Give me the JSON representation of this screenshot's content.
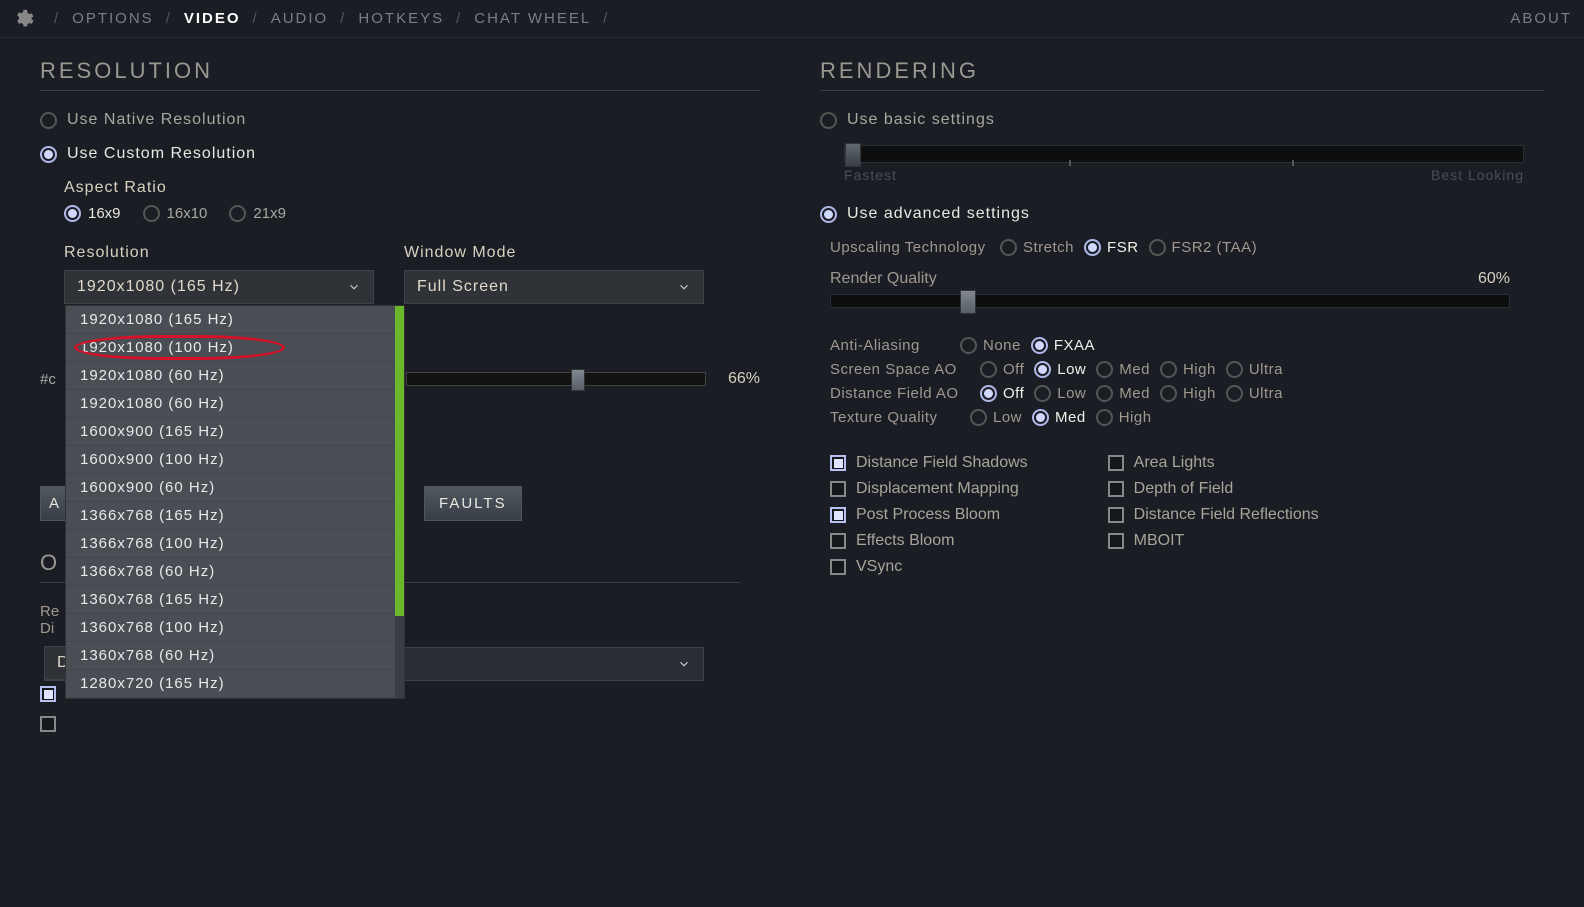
{
  "tabs": {
    "options": "OPTIONS",
    "video": "VIDEO",
    "audio": "AUDIO",
    "hotkeys": "HOTKEYS",
    "chatwheel": "CHAT WHEEL",
    "about": "ABOUT"
  },
  "left": {
    "title": "RESOLUTION",
    "native": "Use Native Resolution",
    "custom": "Use Custom Resolution",
    "aspect_label": "Aspect Ratio",
    "aspects": {
      "a1": "16x9",
      "a2": "16x10",
      "a3": "21x9"
    },
    "res_label": "Resolution",
    "res_selected": "1920x1080 (165 Hz)",
    "res_options": [
      "1920x1080 (165 Hz)",
      "1920x1080 (100 Hz)",
      "1920x1080 (60 Hz)",
      "1920x1080 (60 Hz)",
      "1600x900 (165 Hz)",
      "1600x900 (100 Hz)",
      "1600x900 (60 Hz)",
      "1366x768 (165 Hz)",
      "1366x768 (100 Hz)",
      "1366x768 (60 Hz)",
      "1360x768 (165 Hz)",
      "1360x768 (100 Hz)",
      "1360x768 (60 Hz)",
      "1280x720 (165 Hz)"
    ],
    "win_label": "Window Mode",
    "win_selected": "Full Screen",
    "obscured_slider_prefix": "#c",
    "obscured_slider_val": "66%",
    "apply_btn": "A",
    "defaults_btn": "FAULTS",
    "other_title": "O",
    "other_line1": "Re",
    "other_line2": "Di",
    "other_dd": "D"
  },
  "right": {
    "title": "RENDERING",
    "basic": "Use basic settings",
    "fastest": "Fastest",
    "best": "Best Looking",
    "advanced": "Use advanced settings",
    "upscale_label": "Upscaling Technology",
    "upscale_opts": {
      "o1": "Stretch",
      "o2": "FSR",
      "o3": "FSR2 (TAA)"
    },
    "rq_label": "Render Quality",
    "rq_val": "60%",
    "aa_label": "Anti-Aliasing",
    "aa_opts": {
      "o1": "None",
      "o2": "FXAA"
    },
    "ssao_label": "Screen Space AO",
    "dfao_label": "Distance Field AO",
    "ao_opts": {
      "o1": "Off",
      "o2": "Low",
      "o3": "Med",
      "o4": "High",
      "o5": "Ultra"
    },
    "tex_label": "Texture Quality",
    "tex_opts": {
      "o1": "Low",
      "o2": "Med",
      "o3": "High"
    },
    "checks_left": {
      "c1": "Distance Field Shadows",
      "c2": "Displacement Mapping",
      "c3": "Post Process Bloom",
      "c4": "Effects Bloom",
      "c5": "VSync"
    },
    "checks_right": {
      "c1": "Area Lights",
      "c2": "Depth of Field",
      "c3": "Distance Field Reflections",
      "c4": "MBOIT"
    }
  }
}
